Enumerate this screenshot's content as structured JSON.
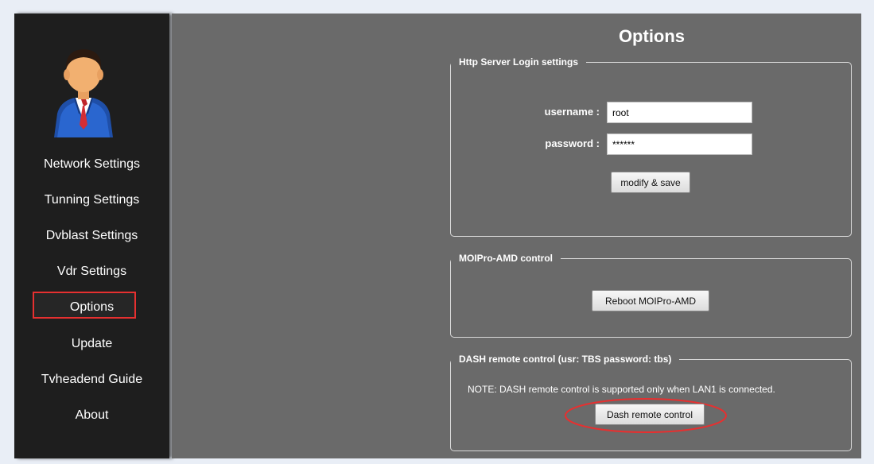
{
  "sidebar": {
    "items": [
      {
        "label": "Network Settings"
      },
      {
        "label": "Tunning Settings"
      },
      {
        "label": "Dvblast Settings"
      },
      {
        "label": "Vdr Settings"
      },
      {
        "label": "Options",
        "selected": true
      },
      {
        "label": "Update"
      },
      {
        "label": "Tvheadend Guide"
      },
      {
        "label": "About"
      }
    ]
  },
  "main": {
    "title": "Options",
    "login_panel": {
      "legend": "Http Server Login settings",
      "username_label": "username :",
      "username_value": "root",
      "password_label": "password :",
      "password_value": "******",
      "save_button": "modify & save"
    },
    "control_panel": {
      "legend": "MOIPro-AMD control",
      "reboot_button": "Reboot MOIPro-AMD"
    },
    "dash_panel": {
      "legend": "DASH remote control (usr: TBS password: tbs)",
      "note": "NOTE: DASH remote control is supported only when LAN1 is connected.",
      "dash_button": "Dash remote control"
    }
  },
  "colors": {
    "sidebar_bg": "#1e1e1e",
    "main_bg": "#6a6a6a",
    "highlight": "#e63030"
  }
}
